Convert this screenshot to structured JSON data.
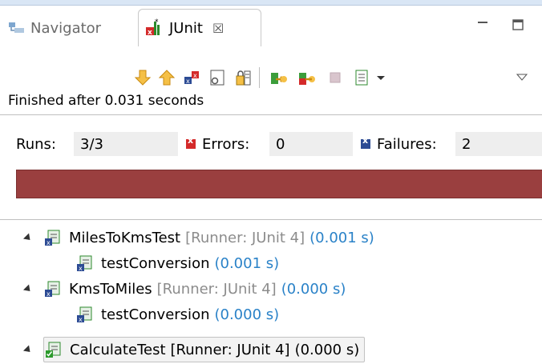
{
  "tabs": {
    "navigator_label": "Navigator",
    "junit_label": "JUnit",
    "close_glyph": "☒"
  },
  "toolbar": {
    "icons": [
      "next-failure-icon",
      "previous-failure-icon",
      "show-failures-only-icon",
      "scroll-lock-icon",
      "show-skipped-icon",
      "rerun-test-icon",
      "rerun-failed-first-icon",
      "stop-icon",
      "test-run-history-icon",
      "dropdown-arrow-icon",
      "view-menu-icon"
    ]
  },
  "status": {
    "text": "Finished after 0.031 seconds"
  },
  "counters": {
    "runs_label": "Runs:",
    "runs_value": "3/3",
    "errors_label": "Errors:",
    "errors_value": "0",
    "failures_label": "Failures:",
    "failures_value": "2"
  },
  "progress": {
    "fraction": 1.0,
    "color": "#9a3f3f"
  },
  "tree": [
    {
      "name": "MilesToKmsTest",
      "runner": "[Runner: JUnit 4]",
      "time": "(0.001 s)",
      "status": "failed",
      "children": [
        {
          "name": "testConversion",
          "time": "(0.001 s)"
        }
      ]
    },
    {
      "name": "KmsToMiles",
      "runner": "[Runner: JUnit 4]",
      "time": "(0.000 s)",
      "status": "failed",
      "children": [
        {
          "name": "testConversion",
          "time": "(0.000 s)"
        }
      ]
    },
    {
      "name": "CalculateTest",
      "runner": "[Runner: JUnit 4]",
      "time": "(0.000 s)",
      "status": "passed",
      "children": []
    }
  ]
}
